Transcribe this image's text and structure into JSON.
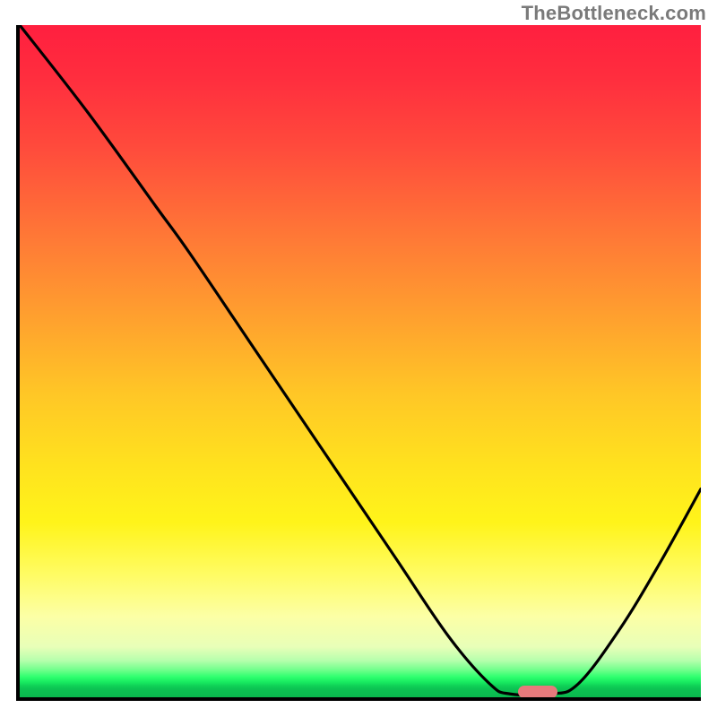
{
  "watermark": "TheBottleneck.com",
  "chart_data": {
    "type": "line",
    "title": "",
    "xlabel": "",
    "ylabel": "",
    "xlim": [
      0,
      100
    ],
    "ylim": [
      0,
      100
    ],
    "grid": false,
    "legend": null,
    "background": {
      "kind": "vertical-gradient",
      "stops": [
        {
          "pct": 0,
          "color": "#ff1f3f"
        },
        {
          "pct": 18,
          "color": "#ff4a3c"
        },
        {
          "pct": 44,
          "color": "#ffa22e"
        },
        {
          "pct": 66,
          "color": "#ffe31e"
        },
        {
          "pct": 88,
          "color": "#fcffa6"
        },
        {
          "pct": 96,
          "color": "#6dff8a"
        },
        {
          "pct": 100,
          "color": "#0ab84e"
        }
      ]
    },
    "series": [
      {
        "name": "bottleneck-curve",
        "color": "#000000",
        "points": [
          {
            "x": 0,
            "y": 100
          },
          {
            "x": 10,
            "y": 87
          },
          {
            "x": 20,
            "y": 73
          },
          {
            "x": 25,
            "y": 66
          },
          {
            "x": 35,
            "y": 51
          },
          {
            "x": 45,
            "y": 36
          },
          {
            "x": 55,
            "y": 21
          },
          {
            "x": 63,
            "y": 9
          },
          {
            "x": 69,
            "y": 2
          },
          {
            "x": 72,
            "y": 0.5
          },
          {
            "x": 78,
            "y": 0.5
          },
          {
            "x": 82,
            "y": 2
          },
          {
            "x": 88,
            "y": 10
          },
          {
            "x": 94,
            "y": 20
          },
          {
            "x": 100,
            "y": 31
          }
        ]
      }
    ],
    "marker": {
      "name": "optimal-point",
      "x": 76,
      "y": 0.8,
      "color": "#e77a7c",
      "shape": "capsule"
    }
  }
}
